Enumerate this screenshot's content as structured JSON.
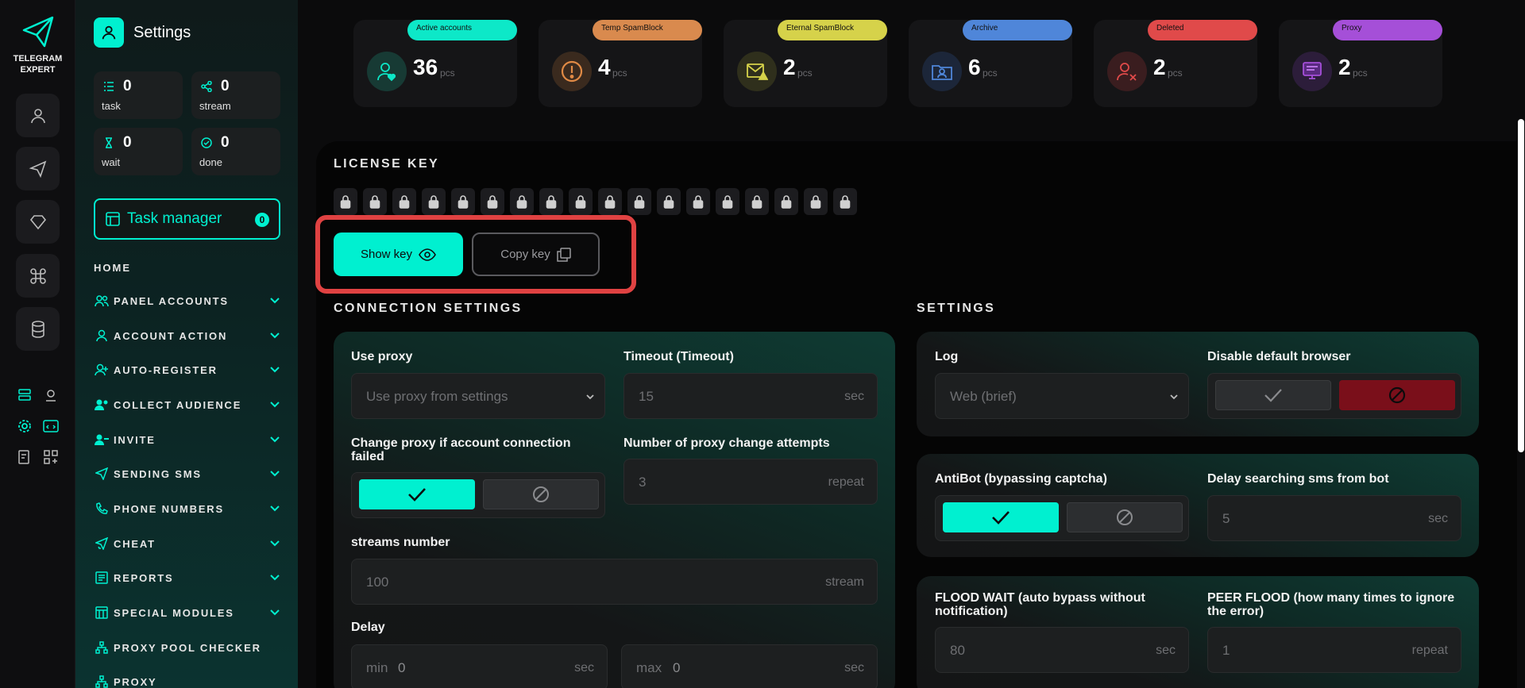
{
  "brand": {
    "name": "TELEGRAM\nEXPERT"
  },
  "rail": {
    "buttons": [
      "user-icon",
      "send-icon",
      "diamond-icon",
      "command-icon",
      "database-icon"
    ],
    "mini_icons": [
      "server-list-icon",
      "map-pin-user-icon",
      "gear-icon",
      "code-window-icon",
      "checklist-icon",
      "grid-add-icon"
    ]
  },
  "sidebar": {
    "title": "Settings",
    "stats": [
      {
        "value": "0",
        "label": "task",
        "icon": "list-icon"
      },
      {
        "value": "0",
        "label": "stream",
        "icon": "share-icon"
      },
      {
        "value": "0",
        "label": "wait",
        "icon": "hourglass-icon"
      },
      {
        "value": "0",
        "label": "done",
        "icon": "check-circle-icon"
      }
    ],
    "task_manager": {
      "label": "Task manager",
      "count": "0"
    },
    "home": "HOME",
    "nav": [
      {
        "label": "PANEL ACCOUNTS",
        "icon": "users-icon",
        "chevron": true
      },
      {
        "label": "ACCOUNT ACTION",
        "icon": "user-icon",
        "chevron": true
      },
      {
        "label": "AUTO-REGISTER",
        "icon": "user-plus-icon",
        "chevron": true
      },
      {
        "label": "COLLECT AUDIENCE",
        "icon": "user-group-icon",
        "chevron": true
      },
      {
        "label": "INVITE",
        "icon": "user-invite-icon",
        "chevron": true
      },
      {
        "label": "SENDING SMS",
        "icon": "send-icon",
        "chevron": true
      },
      {
        "label": "PHONE NUMBERS",
        "icon": "phone-icon",
        "chevron": true
      },
      {
        "label": "CHEAT",
        "icon": "send-star-icon",
        "chevron": true
      },
      {
        "label": "REPORTS",
        "icon": "report-icon",
        "chevron": true
      },
      {
        "label": "SPECIAL MODULES",
        "icon": "module-icon",
        "chevron": true
      },
      {
        "label": "PROXY POOL CHECKER",
        "icon": "network-icon",
        "chevron": false
      },
      {
        "label": "PROXY",
        "icon": "network-icon",
        "chevron": false
      }
    ]
  },
  "stat_cards": [
    {
      "label": "Active accounts",
      "value": "36",
      "unit": "pcs",
      "color": "#0de8c8",
      "icon": "user-heart-icon"
    },
    {
      "label": "Temp SpamBlock",
      "value": "4",
      "unit": "pcs",
      "color": "#d98a4e",
      "icon": "alert-circle-icon"
    },
    {
      "label": "Eternal SpamBlock",
      "value": "2",
      "unit": "pcs",
      "color": "#d6d24a",
      "icon": "mail-warning-icon"
    },
    {
      "label": "Archive",
      "value": "6",
      "unit": "pcs",
      "color": "#4f86d9",
      "icon": "archive-user-icon"
    },
    {
      "label": "Deleted",
      "value": "2",
      "unit": "pcs",
      "color": "#e04a4a",
      "icon": "user-x-icon"
    },
    {
      "label": "Proxy",
      "value": "2",
      "unit": "pcs",
      "color": "#a54fd8",
      "icon": "proxy-icon"
    }
  ],
  "license": {
    "title": "LICENSE KEY",
    "lock_count": 18,
    "show_key": "Show key",
    "copy_key": "Copy key"
  },
  "connection": {
    "title": "CONNECTION SETTINGS",
    "use_proxy": {
      "label": "Use proxy",
      "value": "Use proxy from settings"
    },
    "timeout": {
      "label": "Timeout (Timeout)",
      "value": "15",
      "unit": "sec"
    },
    "change_proxy": {
      "label": "Change proxy if account connection failed",
      "enabled": true
    },
    "proxy_attempts": {
      "label": "Number of proxy change attempts",
      "value": "3",
      "unit": "repeat"
    },
    "streams": {
      "label": "streams number",
      "value": "100",
      "unit": "stream"
    },
    "delay": {
      "label": "Delay",
      "min_label": "min",
      "min_value": "0",
      "max_label": "max",
      "max_value": "0",
      "unit": "sec"
    }
  },
  "settings": {
    "title": "SETTINGS",
    "log": {
      "label": "Log",
      "value": "Web (brief)"
    },
    "disable_browser": {
      "label": "Disable default browser",
      "enabled": false
    },
    "antibot": {
      "label": "AntiBot (bypassing captcha)",
      "enabled": true
    },
    "delay_sms": {
      "label": "Delay searching sms from bot",
      "value": "5",
      "unit": "sec"
    },
    "flood_wait": {
      "label": "FLOOD WAIT (auto bypass without notification)",
      "value": "80",
      "unit": "sec"
    },
    "peer_flood": {
      "label": "PEER FLOOD (how many times to ignore the error)",
      "value": "1",
      "unit": "repeat"
    }
  },
  "colors": {
    "accent": "#00f0d0",
    "danger": "#e04242",
    "disabled_red": "#7a0f1a"
  }
}
